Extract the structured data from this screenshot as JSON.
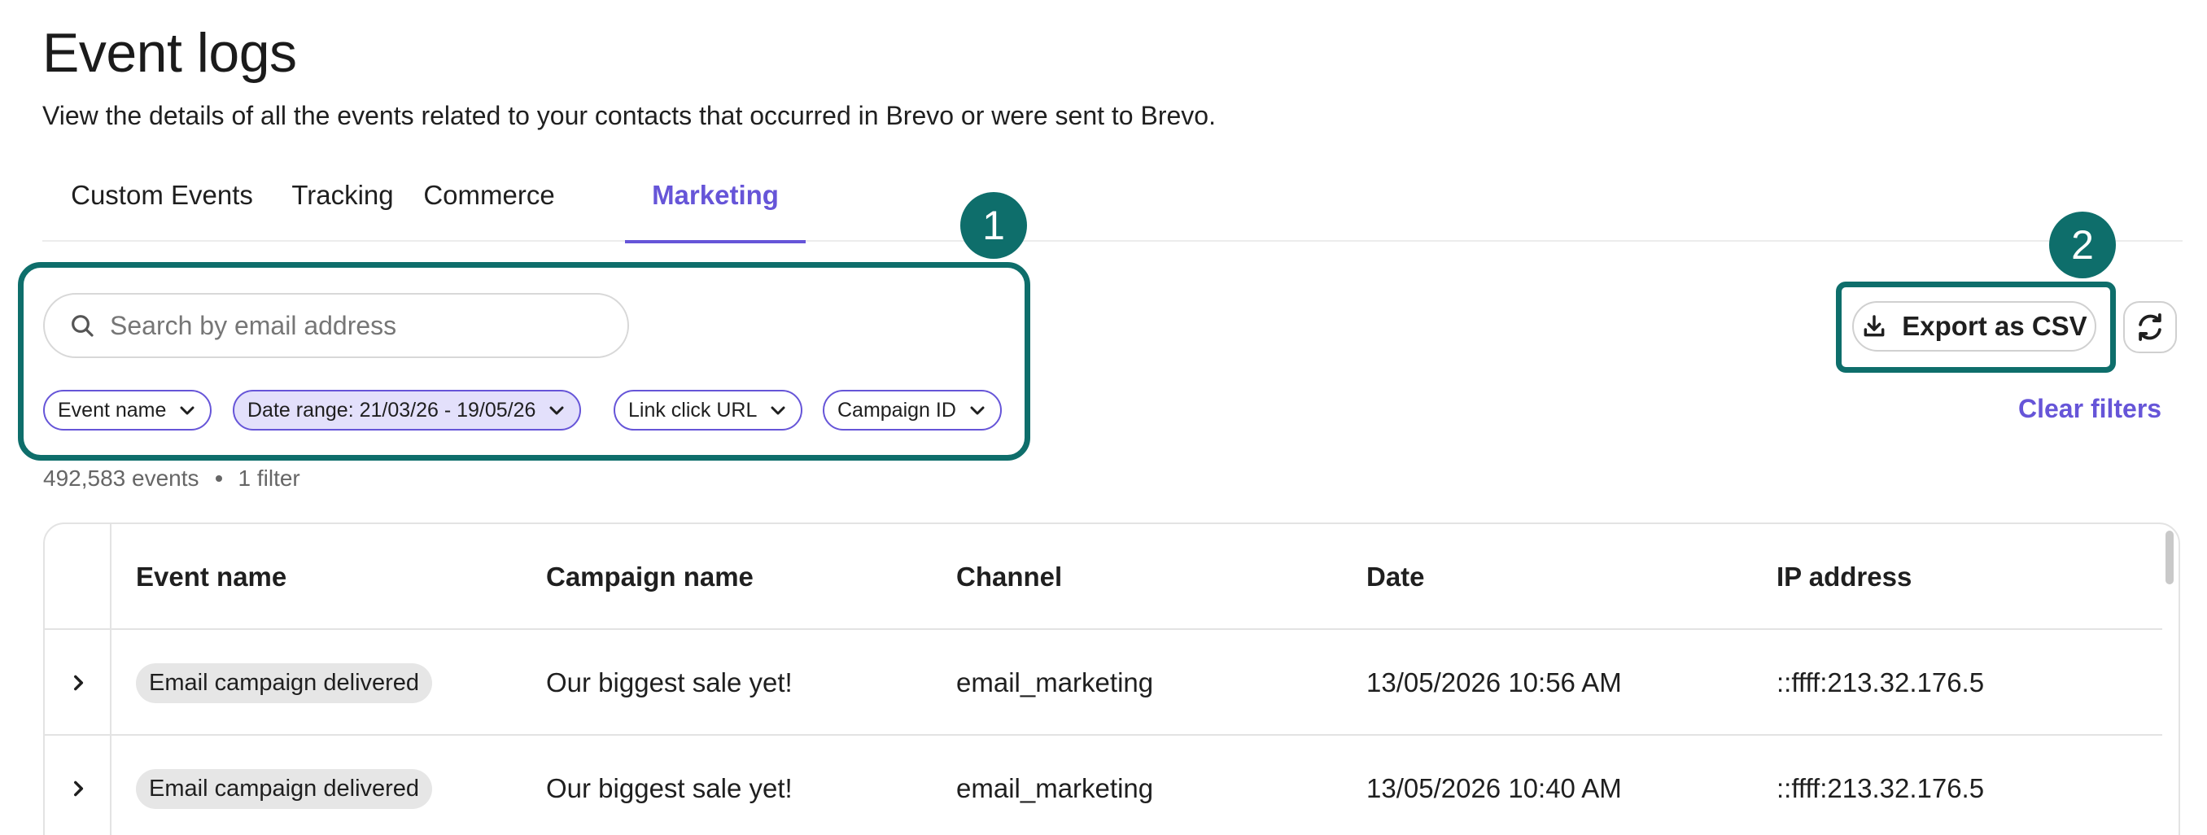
{
  "header": {
    "title": "Event logs",
    "subtitle": "View the details of all the events related to your contacts that occurred in Brevo or were sent to Brevo."
  },
  "tabs": [
    {
      "label": "Custom Events",
      "active": false
    },
    {
      "label": "Tracking",
      "active": false
    },
    {
      "label": "Commerce",
      "active": false
    },
    {
      "label": "Marketing",
      "active": true
    }
  ],
  "annotations": {
    "badge_1": "1",
    "badge_2": "2"
  },
  "search": {
    "placeholder": "Search by email address",
    "value": ""
  },
  "filters": [
    {
      "label": "Event name",
      "active": false
    },
    {
      "label": "Date range: 21/03/26 - 19/05/26",
      "active": true
    },
    {
      "label": "Link click URL",
      "active": false
    },
    {
      "label": "Campaign ID",
      "active": false
    }
  ],
  "toolbar": {
    "export_label": "Export as CSV",
    "clear_filters_label": "Clear filters"
  },
  "summary": {
    "events": "492,583 events",
    "filters": "1 filter"
  },
  "table": {
    "columns": [
      "Event name",
      "Campaign name",
      "Channel",
      "Date",
      "IP address"
    ],
    "rows": [
      {
        "event": "Email campaign delivered",
        "campaign": "Our biggest sale yet!",
        "channel": "email_marketing",
        "date": "13/05/2026 10:56 AM",
        "ip": "::ffff:213.32.176.5"
      },
      {
        "event": "Email campaign delivered",
        "campaign": "Our biggest sale yet!",
        "channel": "email_marketing",
        "date": "13/05/2026 10:40 AM",
        "ip": "::ffff:213.32.176.5"
      }
    ]
  },
  "colors": {
    "accent": "#6655d8",
    "annotation": "#0e6e6b",
    "active_chip_bg": "#e3e0fb"
  },
  "icons": {
    "search": "search-icon",
    "chevron": "chevron-down-icon",
    "download": "download-icon",
    "refresh": "refresh-icon",
    "expand": "chevron-right-icon"
  }
}
